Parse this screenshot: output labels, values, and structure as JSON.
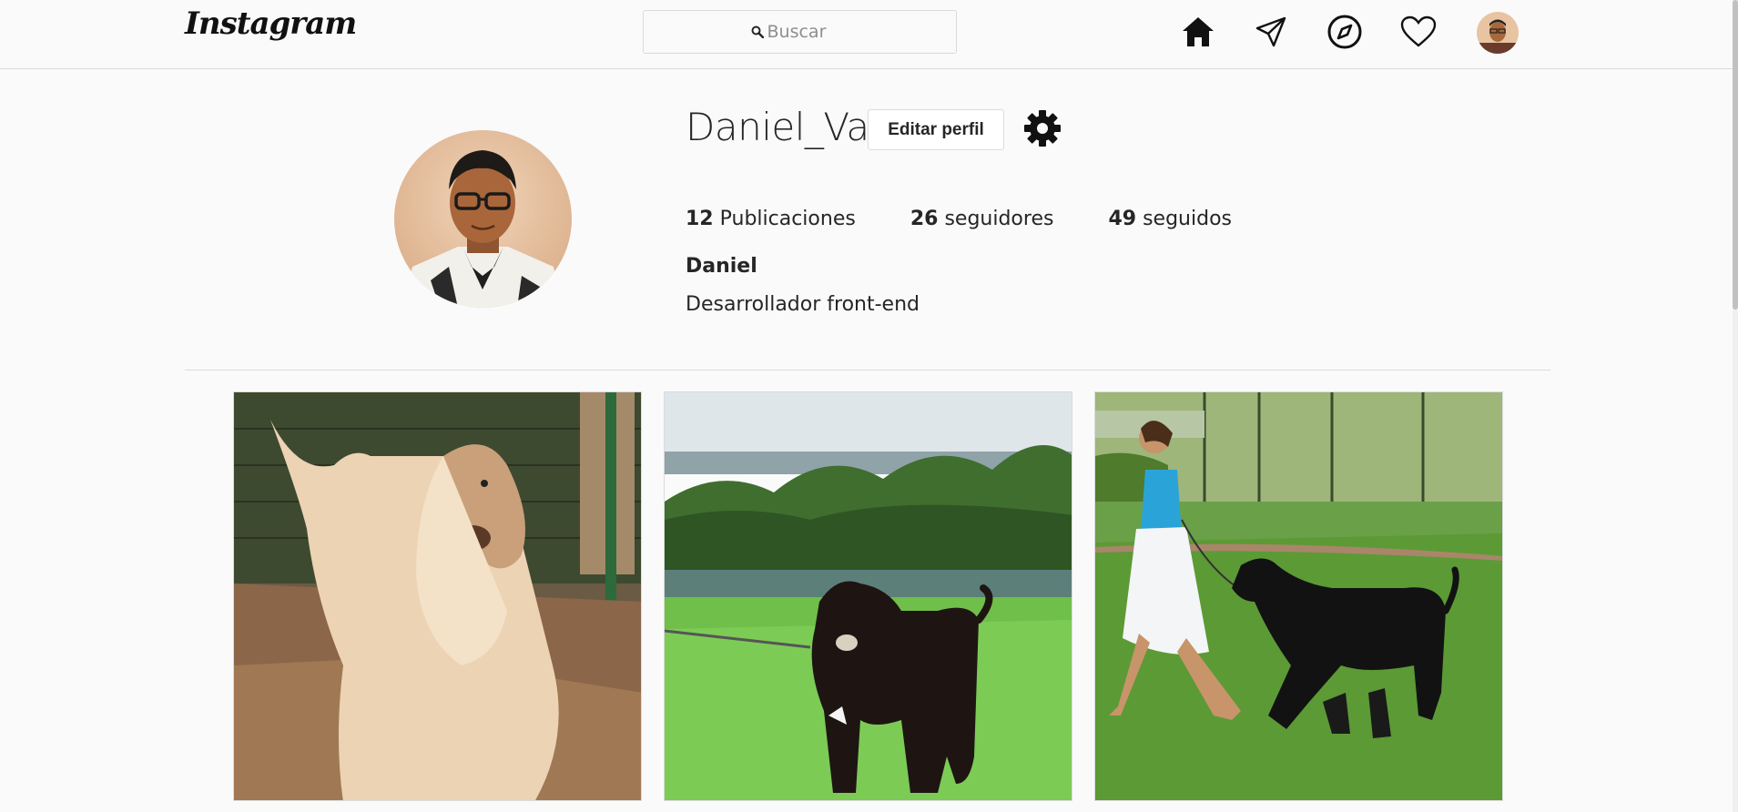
{
  "header": {
    "logo_text": "Instagram",
    "search": {
      "placeholder": "Buscar",
      "icon": "search-icon"
    },
    "nav_icons": [
      "home-icon",
      "direct-icon",
      "explore-icon",
      "activity-icon",
      "profile-avatar"
    ]
  },
  "profile": {
    "username": "Daniel_Vas",
    "edit_button": "Editar perfil",
    "settings_icon": "gear-icon",
    "stats": {
      "posts_count": "12",
      "posts_label": "Publicaciones",
      "followers_count": "26",
      "followers_label": "seguidores",
      "following_count": "49",
      "following_label": "seguidos"
    },
    "full_name": "Daniel",
    "bio": "Desarrollador front-end"
  },
  "posts": [
    {
      "subject": "cream afghan hound photo"
    },
    {
      "subject": "black dog on lawn by lake photo"
    },
    {
      "subject": "woman running with black afghan hound photo"
    }
  ],
  "colors": {
    "background": "#fafafa",
    "border": "#dbdbdb",
    "text": "#262626",
    "muted": "#8e8e8e"
  }
}
